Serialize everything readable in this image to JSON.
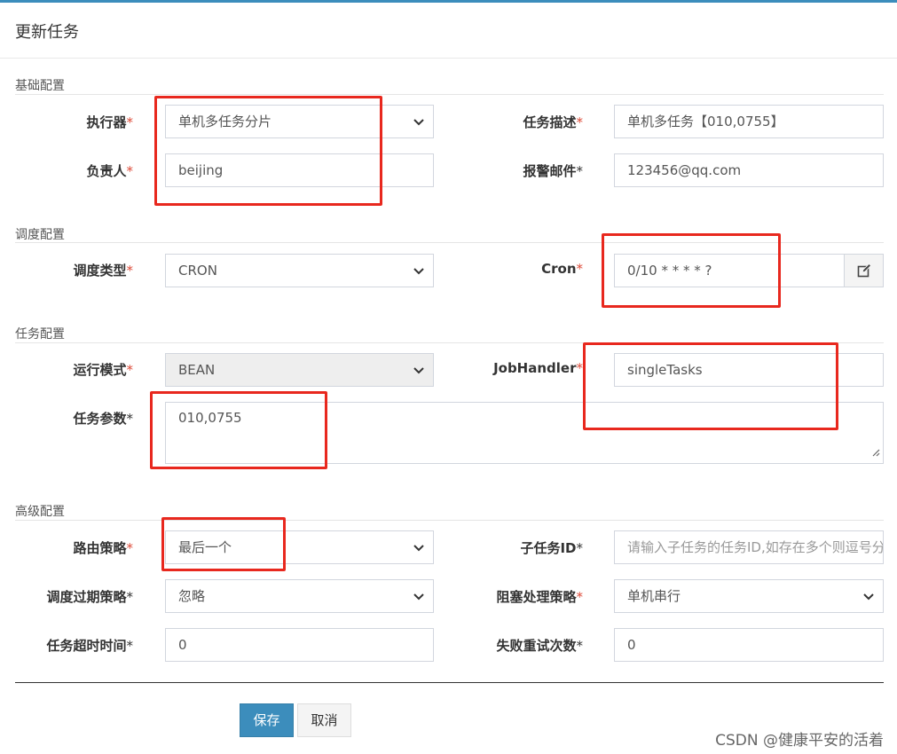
{
  "modal": {
    "title": "更新任务"
  },
  "sections": {
    "basic": "基础配置",
    "schedule": "调度配置",
    "task": "任务配置",
    "advanced": "高级配置"
  },
  "fields": {
    "executor": {
      "label": "执行器",
      "value": "单机多任务分片"
    },
    "job_desc": {
      "label": "任务描述",
      "value": "单机多任务【010,0755】"
    },
    "author": {
      "label": "负责人",
      "value": "beijing"
    },
    "alarm_email": {
      "label": "报警邮件",
      "value": "123456@qq.com"
    },
    "schedule_type": {
      "label": "调度类型",
      "value": "CRON"
    },
    "cron": {
      "label": "Cron",
      "value": "0/10 * * * * ?"
    },
    "run_mode": {
      "label": "运行模式",
      "value": "BEAN"
    },
    "job_handler": {
      "label": "JobHandler",
      "value": "singleTasks"
    },
    "job_param": {
      "label": "任务参数",
      "value": "010,0755"
    },
    "route_strategy": {
      "label": "路由策略",
      "value": "最后一个"
    },
    "child_job_id": {
      "label": "子任务ID",
      "placeholder": "请输入子任务的任务ID,如存在多个则逗号分隔"
    },
    "misfire_strategy": {
      "label": "调度过期策略",
      "value": "忽略"
    },
    "block_strategy": {
      "label": "阻塞处理策略",
      "value": "单机串行"
    },
    "timeout": {
      "label": "任务超时时间",
      "value": "0"
    },
    "fail_retry": {
      "label": "失败重试次数",
      "value": "0"
    }
  },
  "required_mark": "*",
  "buttons": {
    "save": "保存",
    "cancel": "取消"
  },
  "watermark": "CSDN @健康平安的活着",
  "colors": {
    "primary": "#3c8dbc",
    "required": "#dd4b39",
    "highlight": "#e8281e"
  }
}
